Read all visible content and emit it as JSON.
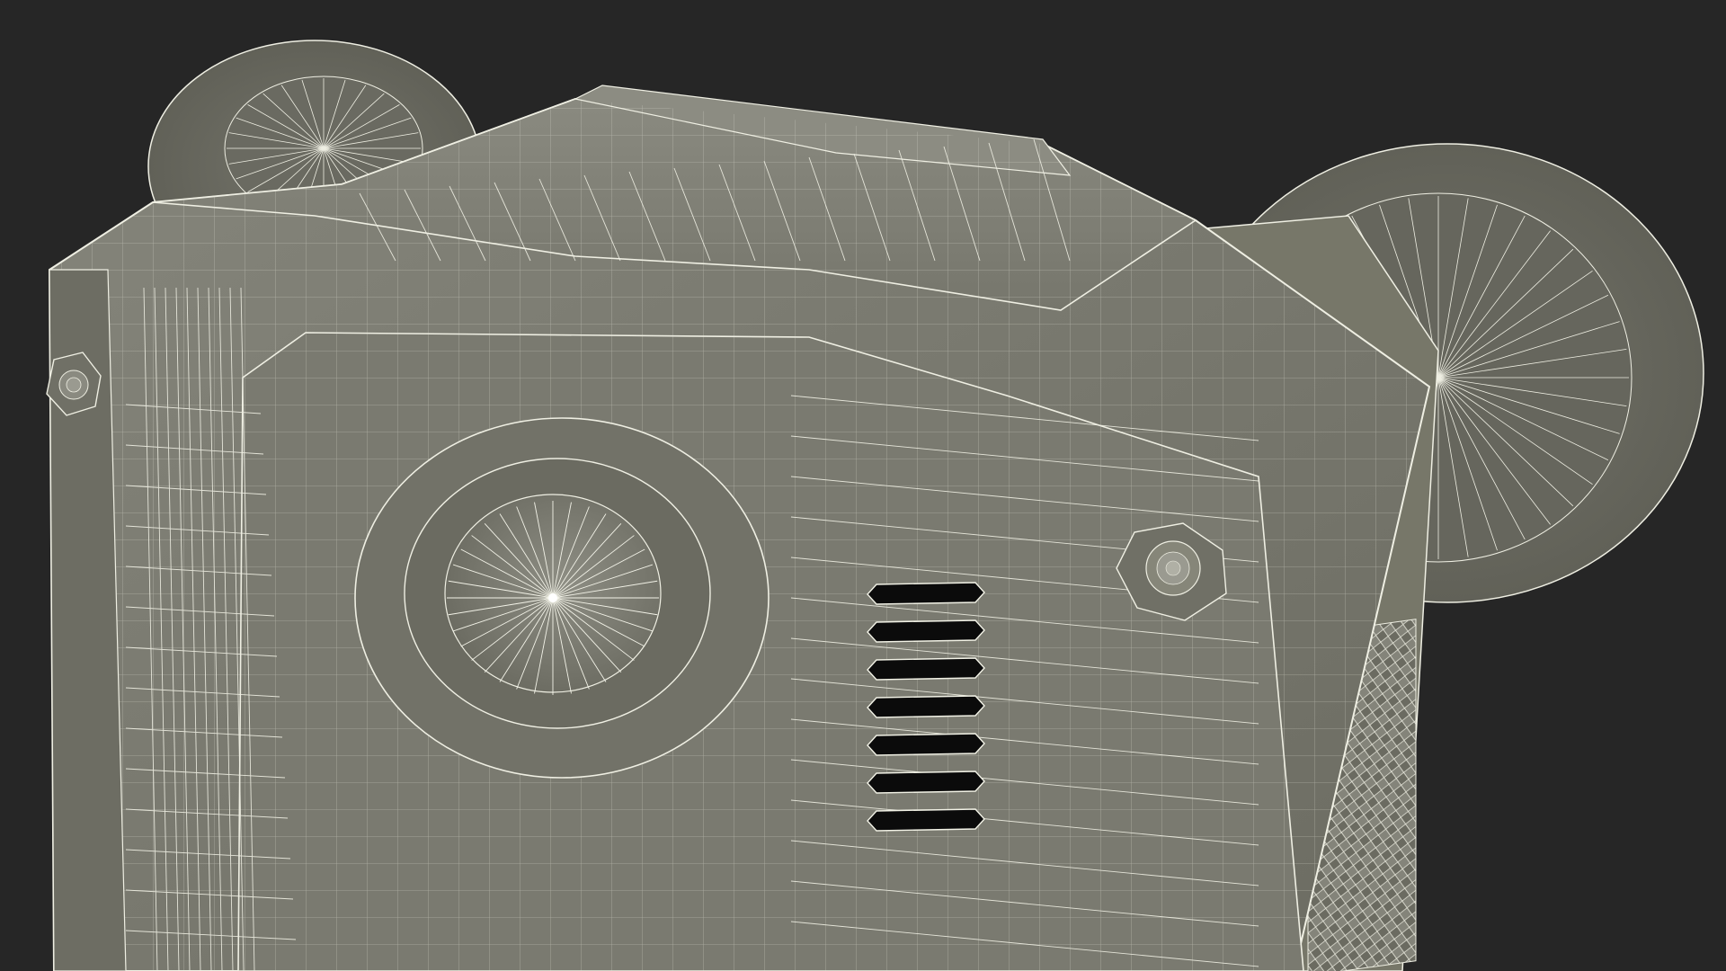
{
  "scene": {
    "background_color": "#262626",
    "body_color": "#7d7d73",
    "body_shade_color": "#6e6e64",
    "body_dark_color": "#5f5f56",
    "wire_color": "#f2f2e6",
    "vent_color": "#0b0b0b",
    "vent_count": 7,
    "bolt_count": 2,
    "knob_count": 2
  }
}
